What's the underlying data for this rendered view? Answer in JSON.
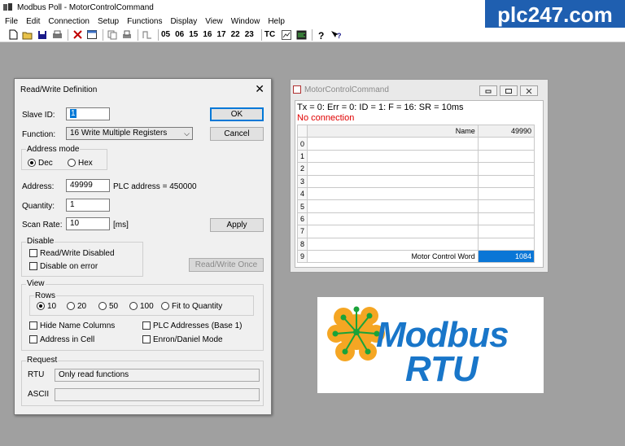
{
  "app": {
    "title": "Modbus Poll - MotorControlCommand",
    "brand": "plc247.com"
  },
  "menu": [
    "File",
    "Edit",
    "Connection",
    "Setup",
    "Functions",
    "Display",
    "View",
    "Window",
    "Help"
  ],
  "toolbar": {
    "function_codes": [
      "05",
      "06",
      "15",
      "16",
      "17",
      "22",
      "23"
    ],
    "tc_label": "TC"
  },
  "dialog": {
    "title": "Read/Write Definition",
    "slave_id_label": "Slave ID:",
    "slave_id_value": "1",
    "ok_label": "OK",
    "function_label": "Function:",
    "function_value": "16 Write Multiple Registers",
    "cancel_label": "Cancel",
    "address_mode_title": "Address mode",
    "dec_label": "Dec",
    "hex_label": "Hex",
    "address_label": "Address:",
    "address_value": "49999",
    "plc_address_text": "PLC address = 450000",
    "quantity_label": "Quantity:",
    "quantity_value": "1",
    "scan_rate_label": "Scan Rate:",
    "scan_rate_value": "10",
    "scan_rate_unit": "[ms]",
    "apply_label": "Apply",
    "disable_title": "Disable",
    "rw_disabled_label": "Read/Write Disabled",
    "disable_on_error_label": "Disable on error",
    "rw_once_label": "Read/Write Once",
    "view_title": "View",
    "rows_title": "Rows",
    "rows_options": [
      "10",
      "20",
      "50",
      "100",
      "Fit to Quantity"
    ],
    "hide_name_columns_label": "Hide Name Columns",
    "plc_addresses_label": "PLC Addresses (Base 1)",
    "address_in_cell_label": "Address in Cell",
    "enron_label": "Enron/Daniel Mode",
    "request_title": "Request",
    "rtu_label": "RTU",
    "rtu_value": "Only read functions",
    "ascii_label": "ASCII",
    "ascii_value": ""
  },
  "mdi": {
    "title": "MotorControlCommand",
    "status": "Tx = 0: Err = 0: ID = 1: F = 16: SR = 10ms",
    "connection": "No connection",
    "header_name": "Name",
    "header_value": "49990",
    "rows": [
      {
        "idx": "0",
        "name": "",
        "value": ""
      },
      {
        "idx": "1",
        "name": "",
        "value": ""
      },
      {
        "idx": "2",
        "name": "",
        "value": ""
      },
      {
        "idx": "3",
        "name": "",
        "value": ""
      },
      {
        "idx": "4",
        "name": "",
        "value": ""
      },
      {
        "idx": "5",
        "name": "",
        "value": ""
      },
      {
        "idx": "6",
        "name": "",
        "value": ""
      },
      {
        "idx": "7",
        "name": "",
        "value": ""
      },
      {
        "idx": "8",
        "name": "",
        "value": ""
      },
      {
        "idx": "9",
        "name": "Motor Control Word",
        "value": "1084"
      }
    ]
  },
  "logo": {
    "word1": "Modbus",
    "word2": "RTU"
  },
  "colors": {
    "brand_blue": "#1f5fb0",
    "logo_blue": "#1976c9",
    "logo_orange": "#f5a623",
    "error_red": "#e00000",
    "selection_blue": "#0a76d6"
  }
}
